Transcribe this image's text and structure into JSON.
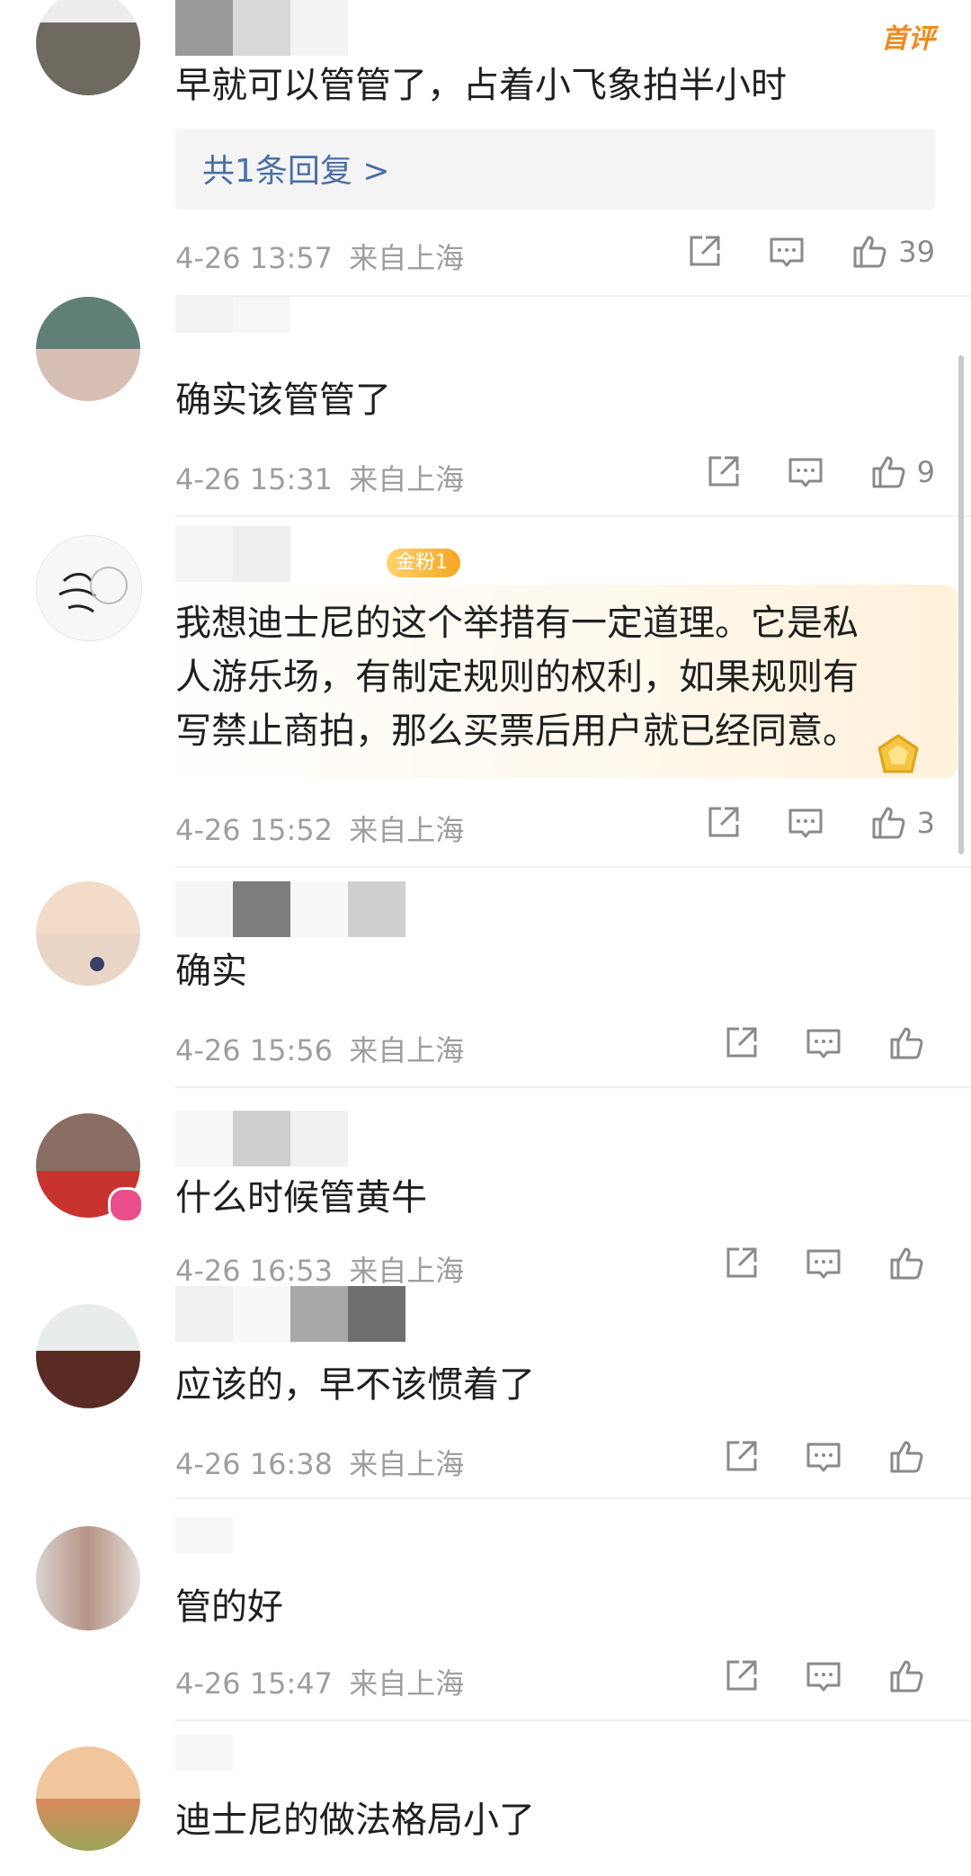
{
  "comments": [
    {
      "text": "早就可以管管了，占着小飞象拍半小时",
      "badge": "首评",
      "reply_label": "共1条回复 >",
      "time": "4-26 13:57",
      "location": "来自上海",
      "likes": "39"
    },
    {
      "text": "确实该管管了",
      "time": "4-26 15:31",
      "location": "来自上海",
      "likes": "9"
    },
    {
      "fan_badge": "金粉1",
      "text_lines": [
        "我想迪士尼的这个举措有一定道理。它是私",
        "人游乐场，有制定规则的权利，如果规则有",
        "写禁止商拍，那么买票后用户就已经同意。"
      ],
      "time": "4-26 15:52",
      "location": "来自上海",
      "likes": "3"
    },
    {
      "text": "确实",
      "time": "4-26 15:56",
      "location": "来自上海",
      "likes": ""
    },
    {
      "text": "什么时候管黄牛",
      "time": "4-26 16:53",
      "location": "来自上海",
      "likes": ""
    },
    {
      "text": "应该的，早不该惯着了",
      "time": "4-26 16:38",
      "location": "来自上海",
      "likes": ""
    },
    {
      "text": "管的好",
      "time": "4-26 15:47",
      "location": "来自上海",
      "likes": ""
    },
    {
      "text": "迪士尼的做法格局小了"
    }
  ],
  "icons": {
    "share": "share-icon",
    "comment": "comment-icon",
    "like": "thumbs-up-icon"
  },
  "colors": {
    "text": "#1f1f1f",
    "meta": "#9e9e9e",
    "link": "#4a6fa5",
    "first_badge": "#f08a1f"
  }
}
